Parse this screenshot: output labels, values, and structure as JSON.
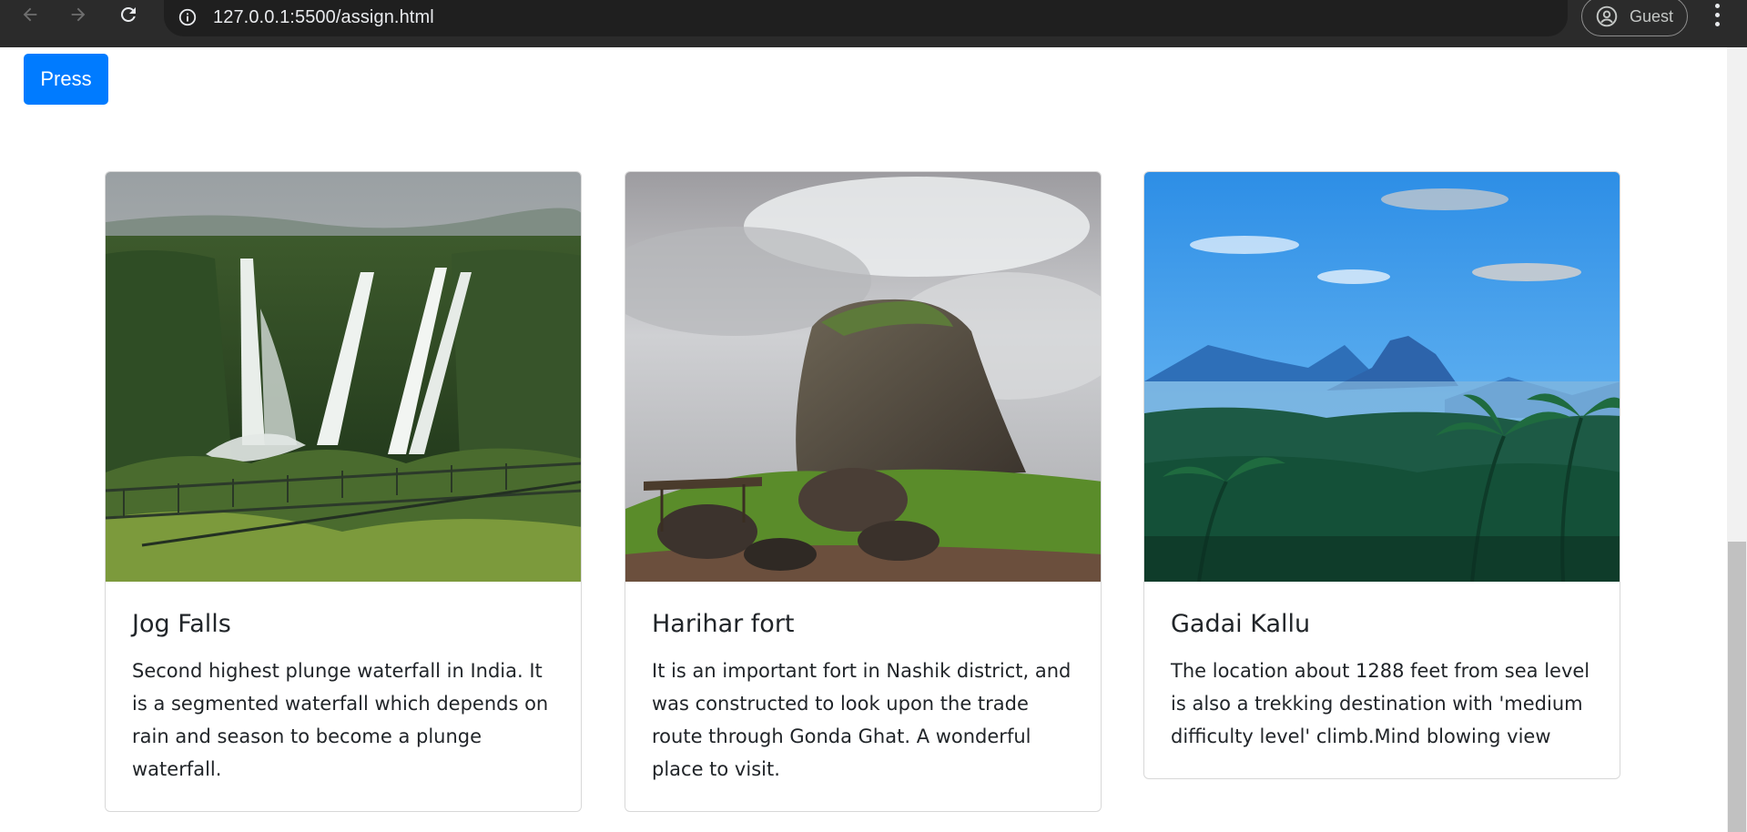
{
  "browser": {
    "url": "127.0.0.1:5500/assign.html",
    "profile_label": "Guest",
    "icons": {
      "back": "arrow-left-icon",
      "forward": "arrow-right-icon",
      "reload": "reload-icon",
      "info": "info-icon",
      "profile": "account-circle-icon",
      "menu": "more-vertical-icon"
    }
  },
  "page": {
    "press_button_label": "Press",
    "accent_color": "#007bff",
    "cards": [
      {
        "title": "Jog Falls",
        "text": "Second highest plunge waterfall in India. It is a segmented waterfall which depends on rain and season to become a plunge waterfall.",
        "image": "waterfall-photo"
      },
      {
        "title": "Harihar fort",
        "text": "It is an important fort in Nashik district, and was constructed to look upon the trade route through Gonda Ghat. A wonderful place to visit.",
        "image": "rock-fort-photo"
      },
      {
        "title": "Gadai Kallu",
        "text": "The location about 1288 feet from sea level is also a trekking destination with 'medium difficulty level' climb.Mind blowing view",
        "image": "palm-forest-mountain-photo"
      }
    ]
  }
}
